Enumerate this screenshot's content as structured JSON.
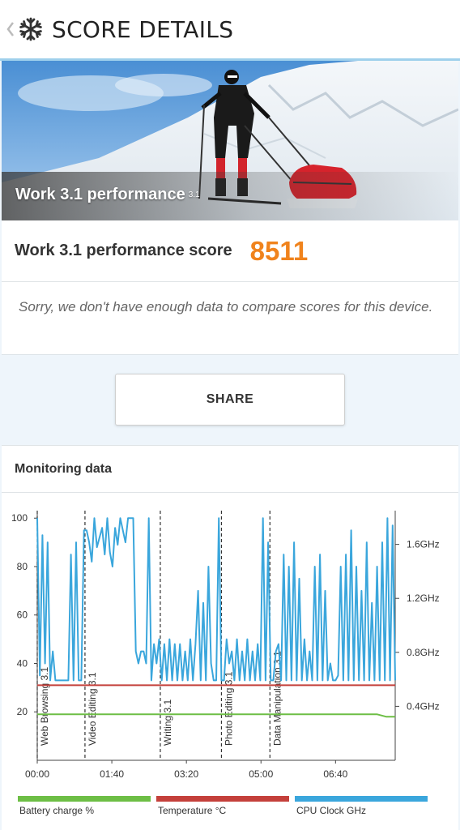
{
  "header": {
    "title": "SCORE DETAILS",
    "back_icon": "chevron-left-icon",
    "logo_icon": "snowflake-icon",
    "accent_color": "#9fd0ec"
  },
  "hero": {
    "title": "Work 3.1 performance",
    "version": "3.1"
  },
  "score": {
    "label": "Work 3.1 performance score",
    "value": "8511",
    "value_color": "#f0831d",
    "compare_text": "Sorry, we don't have enough data to compare scores for this device."
  },
  "share": {
    "label": "SHARE"
  },
  "monitoring": {
    "title": "Monitoring data"
  },
  "chart_data": {
    "type": "line",
    "x_ticks": [
      "00:00",
      "01:40",
      "03:20",
      "05:00",
      "06:40"
    ],
    "x_range_seconds": [
      0,
      480
    ],
    "y_left_ticks": [
      20,
      40,
      60,
      80,
      100
    ],
    "y_left_range": [
      0,
      100
    ],
    "y_right_ticks": [
      "0.4GHz",
      "0.8GHz",
      "1.2GHz",
      "1.6GHz"
    ],
    "y_right_range_ghz": [
      0,
      1.85
    ],
    "segments": [
      {
        "label": "Web Browsing 3.1",
        "start_seconds": 0
      },
      {
        "label": "Video Editing 3.1",
        "start_seconds": 64
      },
      {
        "label": "Writing 3.1",
        "start_seconds": 165
      },
      {
        "label": "Photo Editing 3.1",
        "start_seconds": 247
      },
      {
        "label": "Data Manipulation 3.1",
        "start_seconds": 312
      }
    ],
    "series": [
      {
        "name": "Battery charge %",
        "color": "#6dbe45",
        "values": [
          19,
          19,
          19,
          19,
          19,
          19,
          19,
          19,
          19,
          19,
          19,
          19,
          19,
          19,
          19,
          19,
          19,
          19,
          19,
          19,
          19,
          19,
          19,
          19,
          19,
          19,
          19,
          19,
          19,
          19,
          19,
          19,
          19,
          19,
          19,
          19,
          19,
          19,
          18,
          18
        ]
      },
      {
        "name": "Temperature °C",
        "color": "#c4403b",
        "values": [
          31,
          31,
          31,
          31,
          31,
          31,
          31,
          31,
          31,
          31,
          31,
          31,
          31,
          31,
          31,
          31,
          31,
          31,
          31,
          31,
          31,
          31,
          31,
          31,
          31,
          31,
          31,
          31,
          31,
          31,
          31,
          31,
          31,
          31,
          31,
          31,
          31,
          31,
          31,
          31
        ]
      },
      {
        "name": "CPU Clock GHz",
        "color": "#3aa6dc",
        "values": [
          100,
          35,
          93,
          40,
          90,
          33,
          45,
          33,
          33,
          33,
          33,
          33,
          33,
          85,
          33,
          90,
          33,
          33,
          95,
          95,
          90,
          82,
          100,
          88,
          92,
          96,
          85,
          100,
          86,
          80,
          96,
          89,
          100,
          95,
          90,
          100,
          100,
          100,
          45,
          40,
          45,
          45,
          40,
          100,
          33,
          48,
          40,
          50,
          33,
          48,
          33,
          50,
          33,
          48,
          33,
          48,
          33,
          45,
          33,
          50,
          33,
          48,
          70,
          33,
          65,
          33,
          80,
          40,
          33,
          33,
          100,
          33,
          33,
          50,
          40,
          45,
          33,
          50,
          33,
          45,
          33,
          50,
          33,
          45,
          33,
          48,
          33,
          100,
          33,
          90,
          33,
          33,
          45,
          48,
          33,
          85,
          33,
          80,
          33,
          90,
          33,
          75,
          33,
          50,
          33,
          45,
          33,
          80,
          33,
          85,
          33,
          70,
          33,
          40,
          33,
          33,
          35,
          80,
          33,
          85,
          33,
          95,
          33,
          80,
          33,
          70,
          33,
          90,
          33,
          65,
          33,
          80,
          33,
          90,
          33,
          100,
          33,
          97,
          33
        ]
      }
    ],
    "legend": [
      {
        "label": "Battery charge %",
        "color": "#6dbe45"
      },
      {
        "label": "Temperature °C",
        "color": "#c4403b"
      },
      {
        "label": "CPU Clock GHz",
        "color": "#3aa6dc"
      }
    ]
  }
}
